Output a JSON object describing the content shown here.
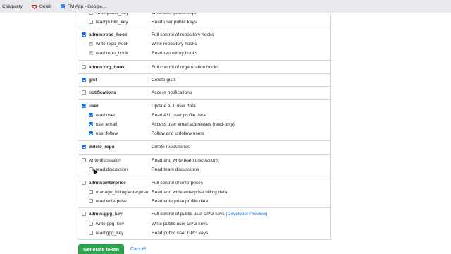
{
  "bookmarks": [
    {
      "label": "Coaqwety",
      "icon": "none"
    },
    {
      "label": "Gmail",
      "icon": "gmail-icon"
    },
    {
      "label": "FM App - Google...",
      "icon": "sheets-icon"
    }
  ],
  "scopes": {
    "public_key_cut": {
      "name": "write:public_key",
      "desc": "Write user public keys"
    },
    "read_public_key": {
      "name": "read:public_key",
      "desc": "Read user public keys",
      "checked": false
    },
    "admin_repo_hook": {
      "name": "admin:repo_hook",
      "desc": "Full control of repository hooks",
      "checked": true
    },
    "write_repo_hook": {
      "name": "write:repo_hook",
      "desc": "Write repository hooks",
      "checked": true
    },
    "read_repo_hook": {
      "name": "read:repo_hook",
      "desc": "Read repository hooks",
      "checked": true
    },
    "admin_org_hook": {
      "name": "admin:org_hook",
      "desc": "Full control of organization hooks",
      "checked": false
    },
    "gist": {
      "name": "gist",
      "desc": "Create gists",
      "checked": true
    },
    "notifications": {
      "name": "notifications",
      "desc": "Access notifications",
      "checked": false
    },
    "user": {
      "name": "user",
      "desc": "Update ALL user data",
      "checked": true
    },
    "read_user": {
      "name": "read:user",
      "desc": "Read ALL user profile data",
      "checked": true
    },
    "user_email": {
      "name": "user:email",
      "desc": "Access user email addresses (read-only)",
      "checked": true
    },
    "user_follow": {
      "name": "user:follow",
      "desc": "Follow and unfollow users",
      "checked": true
    },
    "delete_repo": {
      "name": "delete_repo",
      "desc": "Delete repositories",
      "checked": true
    },
    "write_discussion": {
      "name": "write:discussion",
      "desc": "Read and write team discussions",
      "checked": false
    },
    "read_discussion": {
      "name": "read:discussion",
      "desc": "Read team discussions",
      "checked": false
    },
    "admin_enterprise": {
      "name": "admin:enterprise",
      "desc": "Full control of enterprises",
      "checked": false
    },
    "manage_billing": {
      "name": "manage_billing:enterprise",
      "desc": "Read and write enterprise billing data",
      "checked": false
    },
    "read_enterprise": {
      "name": "read:enterprise",
      "desc": "Read enterprise profile data",
      "checked": false
    },
    "admin_gpg_key": {
      "name": "admin:gpg_key",
      "desc": "Full control of public user GPG keys",
      "desc_link": "(Developer Preview)",
      "checked": false
    },
    "write_gpg_key": {
      "name": "write:gpg_key",
      "desc": "Write public user GPG keys",
      "checked": false
    },
    "read_gpg_key": {
      "name": "read:gpg_key",
      "desc": "Read public user GPG keys",
      "checked": false
    }
  },
  "actions": {
    "generate": "Generate token",
    "cancel": "Cancel"
  },
  "colors": {
    "accent": "#0969da",
    "primary_button": "#2da44e"
  }
}
